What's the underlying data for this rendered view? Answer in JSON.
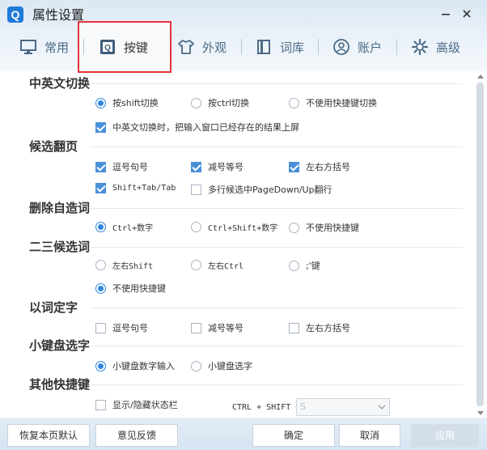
{
  "window": {
    "title": "属性设置",
    "logo": "Q"
  },
  "tabs": [
    {
      "label": "常用",
      "icon": "monitor-icon"
    },
    {
      "label": "按键",
      "icon": "keyboard-q-icon",
      "active": true
    },
    {
      "label": "外观",
      "icon": "shirt-icon"
    },
    {
      "label": "词库",
      "icon": "book-icon"
    },
    {
      "label": "账户",
      "icon": "user-icon"
    },
    {
      "label": "高级",
      "icon": "gear-icon"
    }
  ],
  "sections": {
    "switch": {
      "title": "中英文切换",
      "options": [
        "按shift切换",
        "按ctrl切换",
        "不使用快捷键切换"
      ],
      "selected": 0,
      "commit_option": "中英文切换时，把输入窗口已经存在的结果上屏",
      "commit_checked": true
    },
    "paging": {
      "title": "候选翻页",
      "options": [
        {
          "label": "逗号句号",
          "checked": true
        },
        {
          "label": "减号等号",
          "checked": true
        },
        {
          "label": "左右方括号",
          "checked": true
        },
        {
          "label": "Shift+Tab/Tab",
          "checked": true
        },
        {
          "label": "多行候选中PageDown/Up翻行",
          "checked": false
        }
      ]
    },
    "delete_word": {
      "title": "删除自造词",
      "options": [
        "Ctrl+数字",
        "Ctrl+Shift+数字",
        "不使用快捷键"
      ],
      "selected": 0
    },
    "second_third": {
      "title": "二三候选词",
      "options": [
        "左右Shift",
        "左右Ctrl",
        ";'键",
        "不使用快捷键"
      ],
      "selected": 3
    },
    "word_to_char": {
      "title": "以词定字",
      "options": [
        {
          "label": "逗号句号",
          "checked": false
        },
        {
          "label": "减号等号",
          "checked": false
        },
        {
          "label": "左右方括号",
          "checked": false
        }
      ]
    },
    "numpad": {
      "title": "小键盘选字",
      "options": [
        "小键盘数字输入",
        "小键盘选字"
      ],
      "selected": 0
    },
    "other": {
      "title": "其他快捷键",
      "show_status": "显示/隐藏状态栏",
      "show_status_checked": false,
      "combo_label": "CTRL + SHIFT +",
      "combo_value": "S"
    }
  },
  "footer": {
    "restore": "恢复本页默认",
    "feedback": "意见反馈",
    "ok": "确定",
    "cancel": "取消",
    "apply": "应用"
  },
  "colors": {
    "accent": "#2f86e0",
    "highlight_box": "#e4333a"
  }
}
